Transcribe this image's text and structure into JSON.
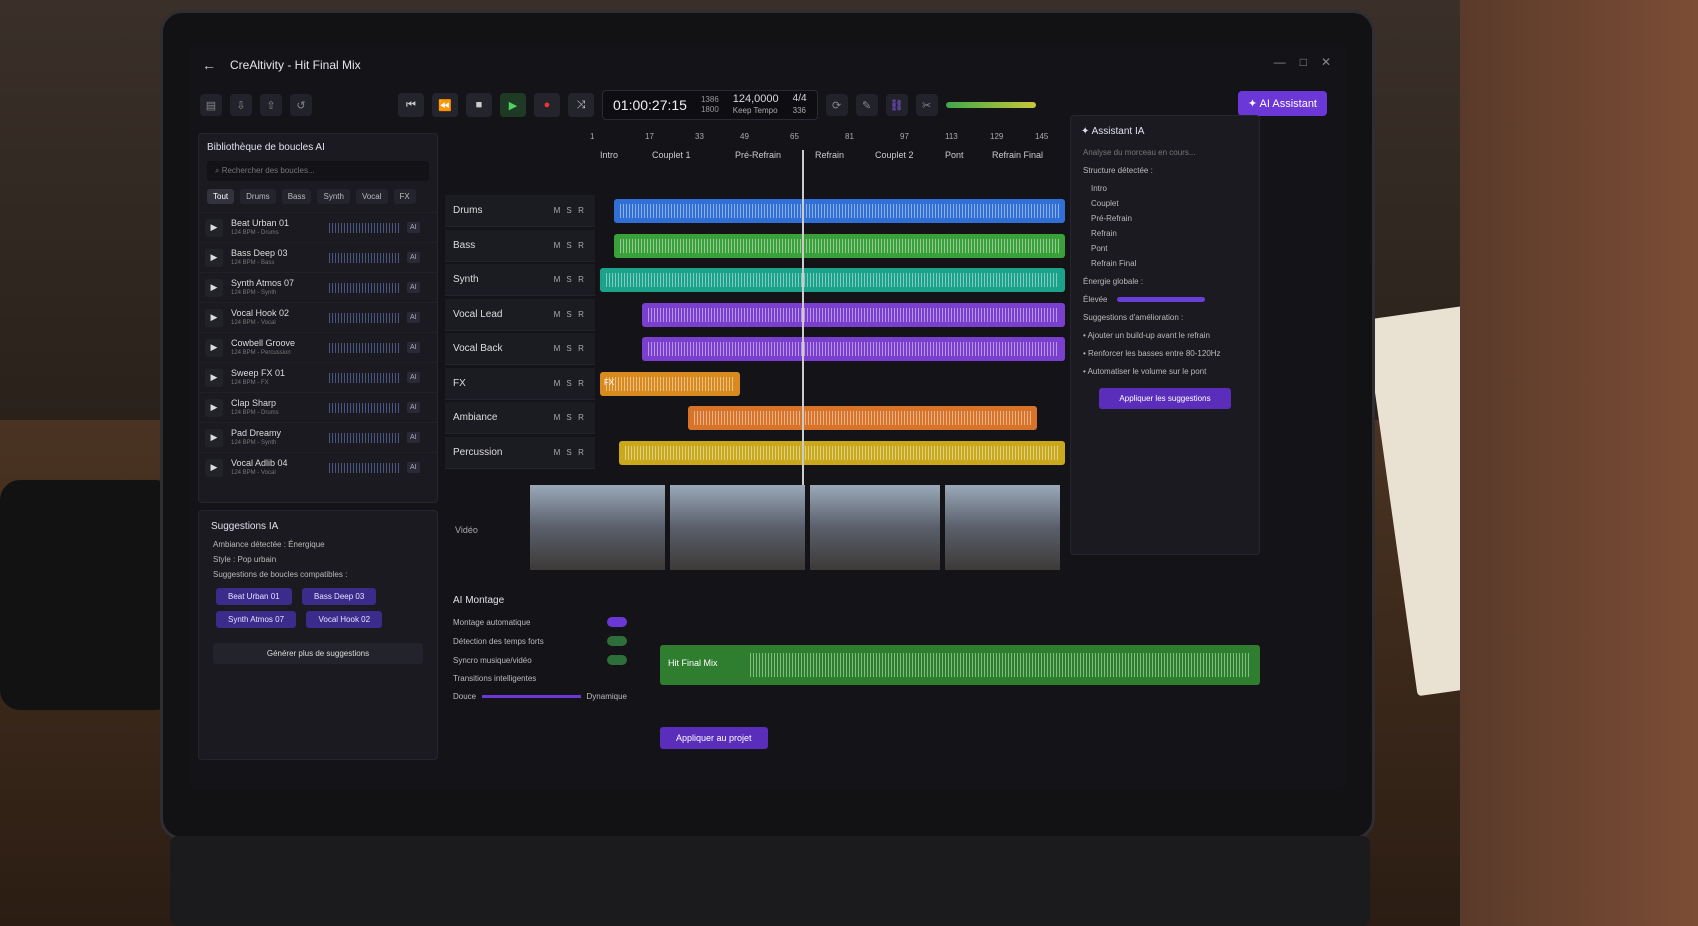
{
  "window": {
    "title": "CreAltivity - Hit Final Mix"
  },
  "transport": {
    "time": "01:00:27:15",
    "bpm_top": "1386",
    "bpm_bottom": "1800",
    "tempo_value": "124,0000",
    "tempo_label": "Keep Tempo",
    "signature_top": "4/4",
    "signature_bottom": "336"
  },
  "ai_button": "AI Assistant",
  "library": {
    "title": "Bibliothèque de boucles AI",
    "search_placeholder": "Rechercher des boucles...",
    "filters": [
      "Tout",
      "Drums",
      "Bass",
      "Synth",
      "Vocal",
      "FX"
    ],
    "loops": [
      {
        "name": "Beat Urban 01",
        "meta": "124 BPM - Drums"
      },
      {
        "name": "Bass Deep 03",
        "meta": "124 BPM - Bass"
      },
      {
        "name": "Synth Atmos 07",
        "meta": "124 BPM - Synth"
      },
      {
        "name": "Vocal Hook 02",
        "meta": "124 BPM - Vocal"
      },
      {
        "name": "Cowbell Groove",
        "meta": "124 BPM - Percussion"
      },
      {
        "name": "Sweep FX 01",
        "meta": "124 BPM - FX"
      },
      {
        "name": "Clap Sharp",
        "meta": "124 BPM - Drums"
      },
      {
        "name": "Pad Dreamy",
        "meta": "124 BPM - Synth"
      },
      {
        "name": "Vocal Adlib 04",
        "meta": "124 BPM - Vocal"
      }
    ],
    "ai_tag": "AI"
  },
  "suggestions": {
    "title": "Suggestions IA",
    "ambiance": "Ambiance détectée : Énergique",
    "style": "Style : Pop urbain",
    "compatible": "Suggestions de boucles compatibles :",
    "chips": [
      "Beat Urban 01",
      "Bass Deep 03",
      "Synth Atmos 07",
      "Vocal Hook 02"
    ],
    "generate": "Générer plus de suggestions"
  },
  "ruler": {
    "numbers": [
      "1",
      "17",
      "33",
      "49",
      "65",
      "81",
      "97",
      "113",
      "129",
      "145"
    ],
    "sections": [
      "Intro",
      "Couplet 1",
      "Pré-Refrain",
      "Refrain",
      "Couplet 2",
      "Pont",
      "Refrain Final"
    ]
  },
  "tracks": [
    "Drums",
    "Bass",
    "Synth",
    "Vocal Lead",
    "Vocal Back",
    "FX",
    "Ambiance",
    "Percussion"
  ],
  "msr": [
    "M",
    "S",
    "R"
  ],
  "fx_clip": "FX",
  "video": {
    "label": "Vidéo"
  },
  "assistant": {
    "title": "Assistant IA",
    "analysis": "Analyse du morceau en cours...",
    "structure_title": "Structure détectée :",
    "structure": [
      "Intro",
      "Couplet",
      "Pré-Refrain",
      "Refrain",
      "Pont",
      "Refrain Final"
    ],
    "energy_title": "Énergie globale :",
    "energy_value": "Élevée",
    "energy_level": 0.8,
    "improve_title": "Suggestions d'amélioration :",
    "improvements": [
      "Ajouter un build-up avant le refrain",
      "Renforcer les basses entre 80-120Hz",
      "Automatiser le volume sur le pont"
    ],
    "apply": "Appliquer les suggestions"
  },
  "montage": {
    "title": "AI Montage",
    "options": [
      "Montage automatique",
      "Détection des temps forts",
      "Syncro musique/vidéo"
    ],
    "transitions": "Transitions intelligentes",
    "slider_left": "Douce",
    "slider_right": "Dynamique",
    "apply": "Appliquer au projet"
  },
  "master": {
    "label": "Hit Final Mix"
  },
  "colors": {
    "accent": "#6b37d6",
    "drums": "#2f6fd6",
    "bass": "#3aa03a",
    "synth": "#1aa38a",
    "vocal": "#7b3fd0",
    "fx": "#d98a1f",
    "ambiance": "#d7742a",
    "percussion": "#c9a81c"
  }
}
